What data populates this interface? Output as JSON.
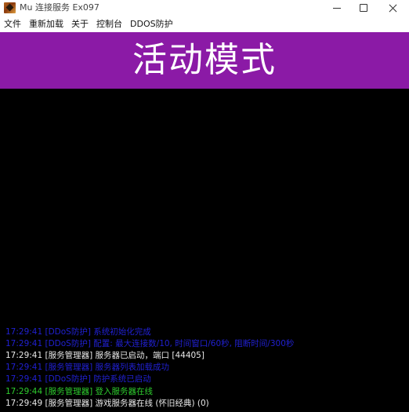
{
  "window": {
    "title": "Mu 连接服务 Ex097",
    "icon": "mu-app-icon"
  },
  "menu": {
    "items": [
      "文件",
      "重新加载",
      "关于",
      "控制台",
      "DDOS防护"
    ]
  },
  "banner": {
    "text": "活动模式",
    "background": "#8b1aa6"
  },
  "console": {
    "background": "#000000",
    "lines": [
      {
        "text": "17:29:41 [DDoS防护] 系统初始化完成",
        "color": "#2020d0"
      },
      {
        "text": "17:29:41 [DDoS防护] 配置: 最大连接数/10, 时间窗口/60秒, 阻断时间/300秒",
        "color": "#2020d0"
      },
      {
        "text": "17:29:41 [服务管理器] 服务器已启动，端口 [44405]",
        "color": "#e8e8e8"
      },
      {
        "text": "17:29:41 [服务管理器] 服务器列表加载成功",
        "color": "#2020d0"
      },
      {
        "text": "17:29:41 [DDoS防护] 防护系统已启动",
        "color": "#2020d0"
      },
      {
        "text": "17:29:44 [服务管理器] 登入服务器在线",
        "color": "#2ecc2e"
      },
      {
        "text": "17:29:49 [服务管理器] 游戏服务器在线 (怀旧经典) (0)",
        "color": "#e8e8e8"
      }
    ]
  }
}
